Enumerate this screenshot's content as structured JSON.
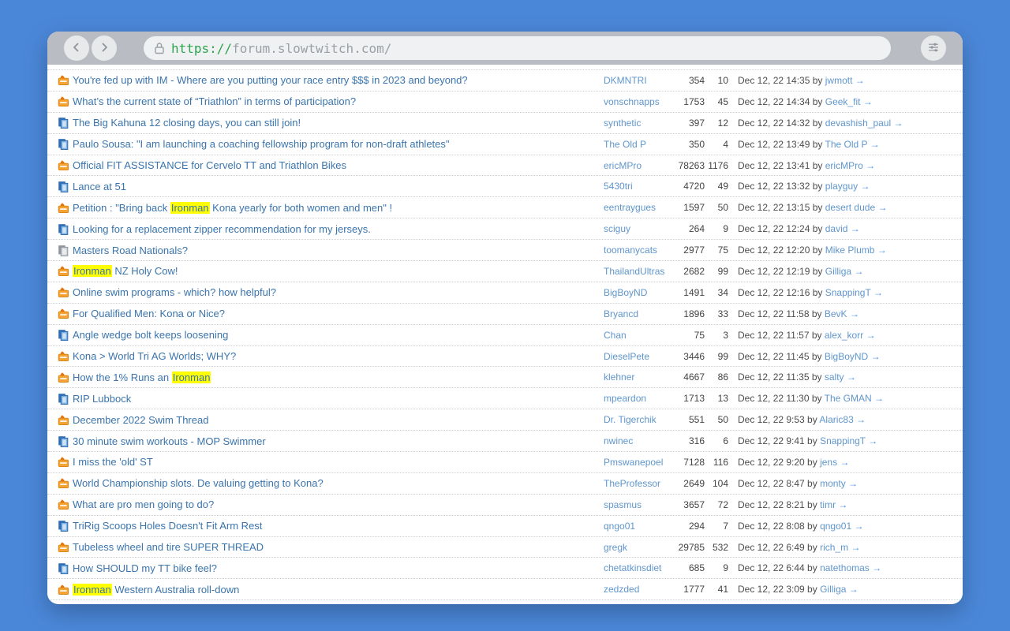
{
  "browser": {
    "url_scheme": "https://",
    "url_host": "forum.slowtwitch.com/",
    "back_icon": "chevron-left",
    "forward_icon": "chevron-right",
    "lock_icon": "padlock",
    "menu_icon": "sliders"
  },
  "list": {
    "by_label": " by ",
    "arrow_glyph": "→",
    "highlight_color": "#ffff00",
    "title_link_color": "#3a74ad",
    "author_link_color": "#6096cc"
  },
  "threads": [
    {
      "icon": "hot-topic",
      "title": "You're fed up with IM - Where are you putting your race entry $$$ in 2023 and beyond?",
      "author": "DKMNTRI",
      "views": "354",
      "replies": "10",
      "last_post": "Dec 12, 22 14:35",
      "last_poster": "jwmott"
    },
    {
      "icon": "hot-topic",
      "title": "What’s the current state of “Triathlon” in terms of participation?",
      "author": "vonschnapps",
      "views": "1753",
      "replies": "45",
      "last_post": "Dec 12, 22 14:34",
      "last_poster": "Geek_fit"
    },
    {
      "icon": "thread",
      "title": "The Big Kahuna 12 closing days, you can still join!",
      "author": "synthetic",
      "views": "397",
      "replies": "12",
      "last_post": "Dec 12, 22 14:32",
      "last_poster": "devashish_paul"
    },
    {
      "icon": "thread",
      "title": "Paulo Sousa: \"I am launching a coaching fellowship program for non-draft athletes\"",
      "author": "The Old P",
      "views": "350",
      "replies": "4",
      "last_post": "Dec 12, 22 13:49",
      "last_poster": "The Old P"
    },
    {
      "icon": "hot-topic",
      "title": "Official FIT ASSISTANCE for Cervelo TT and Triathlon Bikes",
      "author": "ericMPro",
      "views": "78263",
      "replies": "1176",
      "last_post": "Dec 12, 22 13:41",
      "last_poster": "ericMPro"
    },
    {
      "icon": "thread",
      "title": "Lance at 51",
      "author": "5430tri",
      "views": "4720",
      "replies": "49",
      "last_post": "Dec 12, 22 13:32",
      "last_poster": "playguy"
    },
    {
      "icon": "hot-topic",
      "title": "Petition : \"Bring back Ironman Kona yearly for both women and men\" !",
      "highlighted_term": "Ironman",
      "author": "eentraygues",
      "views": "1597",
      "replies": "50",
      "last_post": "Dec 12, 22 13:15",
      "last_poster": "desert dude"
    },
    {
      "icon": "thread",
      "title": "Looking for a replacement zipper recommendation for my jerseys.",
      "author": "sciguy",
      "views": "264",
      "replies": "9",
      "last_post": "Dec 12, 22 12:24",
      "last_poster": "david"
    },
    {
      "icon": "thread-read",
      "title": "Masters Road Nationals?",
      "author": "toomanycats",
      "views": "2977",
      "replies": "75",
      "last_post": "Dec 12, 22 12:20",
      "last_poster": "Mike Plumb"
    },
    {
      "icon": "hot-topic",
      "title": "Ironman NZ Holy Cow!",
      "highlighted_term": "Ironman",
      "author": "ThailandUltras",
      "views": "2682",
      "replies": "99",
      "last_post": "Dec 12, 22 12:19",
      "last_poster": "Gilliga"
    },
    {
      "icon": "hot-topic",
      "title": "Online swim programs - which? how helpful?",
      "author": "BigBoyND",
      "views": "1491",
      "replies": "34",
      "last_post": "Dec 12, 22 12:16",
      "last_poster": "SnappingT"
    },
    {
      "icon": "hot-topic",
      "title": "For Qualified Men: Kona or Nice?",
      "author": "Bryancd",
      "views": "1896",
      "replies": "33",
      "last_post": "Dec 12, 22 11:58",
      "last_poster": "BevK"
    },
    {
      "icon": "thread",
      "title": "Angle wedge bolt keeps loosening",
      "author": "Chan",
      "views": "75",
      "replies": "3",
      "last_post": "Dec 12, 22 11:57",
      "last_poster": "alex_korr"
    },
    {
      "icon": "hot-topic",
      "title": "Kona > World Tri AG Worlds; WHY?",
      "author": "DieselPete",
      "views": "3446",
      "replies": "99",
      "last_post": "Dec 12, 22 11:45",
      "last_poster": "BigBoyND"
    },
    {
      "icon": "hot-topic",
      "title": "How the 1% Runs an Ironman",
      "highlighted_term": "Ironman",
      "author": "klehner",
      "views": "4667",
      "replies": "86",
      "last_post": "Dec 12, 22 11:35",
      "last_poster": "salty"
    },
    {
      "icon": "thread",
      "title": "RIP Lubbock",
      "author": "mpeardon",
      "views": "1713",
      "replies": "13",
      "last_post": "Dec 12, 22 11:30",
      "last_poster": "The GMAN"
    },
    {
      "icon": "hot-topic",
      "title": "December 2022 Swim Thread",
      "author": "Dr. Tigerchik",
      "views": "551",
      "replies": "50",
      "last_post": "Dec 12, 22 9:53",
      "last_poster": "Alaric83"
    },
    {
      "icon": "thread",
      "title": "30 minute swim workouts - MOP Swimmer",
      "author": "nwinec",
      "views": "316",
      "replies": "6",
      "last_post": "Dec 12, 22 9:41",
      "last_poster": "SnappingT"
    },
    {
      "icon": "hot-topic",
      "title": "I miss the 'old' ST",
      "author": "Pmswanepoel",
      "views": "7128",
      "replies": "116",
      "last_post": "Dec 12, 22 9:20",
      "last_poster": "jens"
    },
    {
      "icon": "hot-topic",
      "title": "World Championship slots. De valuing getting to Kona?",
      "author": "TheProfessor",
      "views": "2649",
      "replies": "104",
      "last_post": "Dec 12, 22 8:47",
      "last_poster": "monty"
    },
    {
      "icon": "hot-topic",
      "title": "What are pro men going to do?",
      "author": "spasmus",
      "views": "3657",
      "replies": "72",
      "last_post": "Dec 12, 22 8:21",
      "last_poster": "timr"
    },
    {
      "icon": "thread",
      "title": "TriRig Scoops Holes Doesn't Fit Arm Rest",
      "author": "qngo01",
      "views": "294",
      "replies": "7",
      "last_post": "Dec 12, 22 8:08",
      "last_poster": "qngo01"
    },
    {
      "icon": "hot-topic",
      "title": "Tubeless wheel and tire SUPER THREAD",
      "author": "gregk",
      "views": "29785",
      "replies": "532",
      "last_post": "Dec 12, 22 6:49",
      "last_poster": "rich_m"
    },
    {
      "icon": "thread",
      "title": "How SHOULD my TT bike feel?",
      "author": "chetatkinsdiet",
      "views": "685",
      "replies": "9",
      "last_post": "Dec 12, 22 6:44",
      "last_poster": "natethomas"
    },
    {
      "icon": "hot-topic",
      "title": "Ironman Western Australia roll-down",
      "highlighted_term": "Ironman",
      "author": "zedzded",
      "views": "1777",
      "replies": "41",
      "last_post": "Dec 12, 22 3:09",
      "last_poster": "Gilliga"
    }
  ]
}
